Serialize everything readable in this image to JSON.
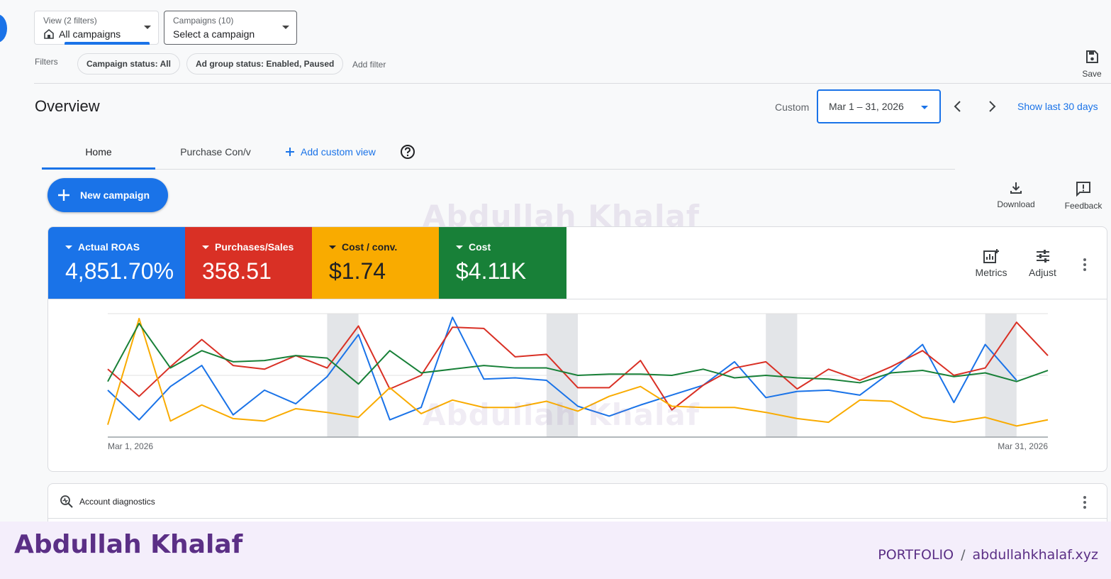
{
  "view_dropdown": {
    "small": "View (2 filters)",
    "value": "All campaigns"
  },
  "campaigns_dropdown": {
    "small": "Campaigns (10)",
    "value": "Select a campaign"
  },
  "filters": {
    "label": "Filters",
    "chips": [
      "Campaign status: All",
      "Ad group status: Enabled, Paused"
    ],
    "add_filter": "Add filter"
  },
  "save_label": "Save",
  "overview": {
    "title": "Overview",
    "custom_label": "Custom",
    "date_range": "Mar 1 – 31, 2026",
    "show_last": "Show last 30 days"
  },
  "tabs": {
    "home": "Home",
    "purchase": "Purchase Con/v",
    "add_custom": "Add custom view"
  },
  "new_campaign": "New campaign",
  "tools": {
    "download": "Download",
    "feedback": "Feedback"
  },
  "watermark": "Abdullah Khalaf",
  "metrics": [
    {
      "name": "Actual ROAS",
      "value": "4,851.70%",
      "color": "#1a73e8"
    },
    {
      "name": "Purchases/Sales",
      "value": "358.51",
      "color": "#d93025"
    },
    {
      "name": "Cost / conv.",
      "value": "$1.74",
      "color": "#f9ab00"
    },
    {
      "name": "Cost",
      "value": "$4.11K",
      "color": "#188038"
    }
  ],
  "card_tools": {
    "metrics": "Metrics",
    "adjust": "Adjust"
  },
  "chart_data": {
    "type": "line",
    "x_start_label": "Mar 1, 2026",
    "x_end_label": "Mar 31, 2026",
    "ylim": [
      0,
      100
    ],
    "grid": true,
    "weekend_bands": [
      [
        7,
        8
      ],
      [
        14,
        15
      ],
      [
        21,
        22
      ],
      [
        28,
        29
      ]
    ],
    "series": [
      {
        "name": "Actual ROAS",
        "color": "#1a73e8",
        "values": [
          38,
          14,
          41,
          58,
          18,
          38,
          27,
          49,
          83,
          14,
          24,
          97,
          47,
          48,
          46,
          25,
          17,
          26,
          34,
          42,
          61,
          32,
          37,
          38,
          34,
          53,
          75,
          28,
          75,
          46
        ]
      },
      {
        "name": "Purchases/Sales",
        "color": "#d93025",
        "values": [
          55,
          33,
          57,
          79,
          58,
          55,
          66,
          56,
          90,
          39,
          50,
          89,
          88,
          65,
          67,
          40,
          40,
          62,
          22,
          42,
          56,
          61,
          39,
          55,
          46,
          57,
          70,
          50,
          56,
          93,
          66
        ]
      },
      {
        "name": "Cost / conv.",
        "color": "#f9ab00",
        "values": [
          10,
          96,
          13,
          26,
          15,
          13,
          23,
          20,
          16,
          40,
          19,
          30,
          24,
          24,
          29,
          21,
          33,
          41,
          25,
          24,
          24,
          20,
          15,
          12,
          30,
          29,
          16,
          12,
          16,
          9,
          14
        ]
      },
      {
        "name": "Cost",
        "color": "#188038",
        "values": [
          45,
          92,
          56,
          70,
          61,
          62,
          66,
          64,
          43,
          70,
          52,
          55,
          58,
          56,
          56,
          50,
          51,
          51,
          50,
          55,
          48,
          50,
          48,
          47,
          44,
          52,
          54,
          49,
          52,
          45,
          54
        ]
      }
    ]
  },
  "diagnostics": {
    "label": "Account diagnostics"
  },
  "footer": {
    "name": "Abdullah Khalaf",
    "portfolio": "PORTFOLIO",
    "slash": "/",
    "site": "abdullahkhalaf.xyz"
  }
}
